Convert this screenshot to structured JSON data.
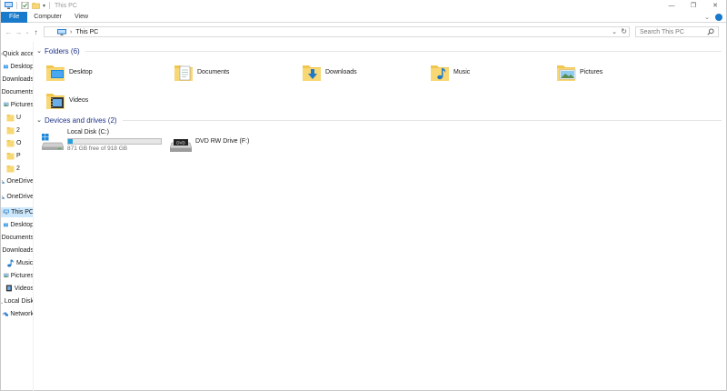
{
  "window": {
    "title": "This PC"
  },
  "ribbon": {
    "tabs": [
      {
        "label": "File",
        "active": true
      },
      {
        "label": "Computer",
        "active": false
      },
      {
        "label": "View",
        "active": false
      }
    ]
  },
  "address": {
    "crumb": "This PC",
    "separator": "›"
  },
  "search": {
    "placeholder": "Search This PC"
  },
  "navpane": {
    "items": [
      {
        "icon": "star-icon",
        "label": "Quick access",
        "chevron": "›"
      },
      {
        "icon": "desktop-icon",
        "label": "Desktop"
      },
      {
        "icon": "download-icon",
        "label": "Downloads"
      },
      {
        "icon": "document-icon",
        "label": "Documents"
      },
      {
        "icon": "pictures-icon",
        "label": "Pictures"
      },
      {
        "icon": "folder-icon",
        "label": "U"
      },
      {
        "icon": "folder-icon",
        "label": "2"
      },
      {
        "icon": "folder-icon",
        "label": "O"
      },
      {
        "icon": "folder-icon",
        "label": "P"
      },
      {
        "icon": "folder-icon",
        "label": "2"
      },
      {
        "icon": "onedrive-icon",
        "label": "OneDrive",
        "chevron": "›"
      },
      {
        "icon": "onedrive-icon",
        "label": "OneDrive",
        "chevron": "›"
      },
      {
        "icon": "this-pc-icon",
        "label": "This PC",
        "chevron": "›",
        "selected": true
      },
      {
        "icon": "desktop-icon",
        "label": "Desktop"
      },
      {
        "icon": "document-icon",
        "label": "Documents"
      },
      {
        "icon": "download-icon",
        "label": "Downloads"
      },
      {
        "icon": "music-icon",
        "label": "Music"
      },
      {
        "icon": "pictures-icon",
        "label": "Pictures"
      },
      {
        "icon": "videos-icon",
        "label": "Videos"
      },
      {
        "icon": "drive-icon",
        "label": "Local Disk"
      },
      {
        "icon": "network-icon",
        "label": "Network",
        "chevron": "›"
      }
    ]
  },
  "folders": {
    "title": "Folders (6)",
    "items": [
      {
        "name": "Desktop",
        "icon": "desktop-folder-icon"
      },
      {
        "name": "Documents",
        "icon": "documents-folder-icon"
      },
      {
        "name": "Downloads",
        "icon": "downloads-folder-icon"
      },
      {
        "name": "Music",
        "icon": "music-folder-icon"
      },
      {
        "name": "Pictures",
        "icon": "pictures-folder-icon"
      },
      {
        "name": "Videos",
        "icon": "videos-folder-icon"
      }
    ]
  },
  "drives": {
    "title": "Devices and drives (2)",
    "items": [
      {
        "name": "Local Disk (C:)",
        "free_text": "871 GB free of 918 GB",
        "used_fraction": 0.051,
        "icon": "windows-drive-icon"
      },
      {
        "name": "DVD RW Drive (F:)",
        "icon": "dvd-drive-icon",
        "badge": "DVD"
      }
    ]
  },
  "colors": {
    "accent": "#1979ca",
    "selection": "#cce8ff",
    "group_title": "#1e3287",
    "folder_yellow": "#f8d775",
    "drive_bar": "#26a0da"
  }
}
